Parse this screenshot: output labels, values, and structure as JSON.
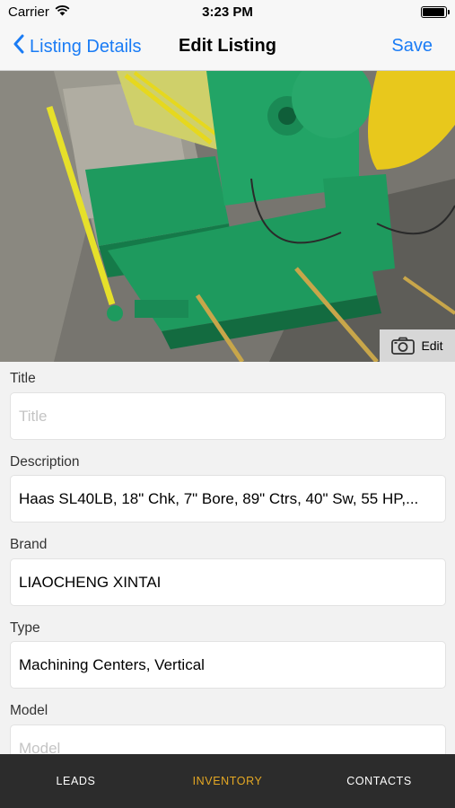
{
  "status_bar": {
    "carrier": "Carrier",
    "time": "3:23 PM",
    "battery_level": 0.95
  },
  "nav": {
    "back_label": "Listing Details",
    "title": "Edit Listing",
    "save_label": "Save",
    "accent_color": "#1a7cf5"
  },
  "photo": {
    "edit_label": "Edit"
  },
  "fields": [
    {
      "label": "Title",
      "value": "",
      "placeholder": "Title"
    },
    {
      "label": "Description",
      "value": "Haas SL40LB, 18\" Chk, 7\" Bore, 89\" Ctrs, 40\" Sw, 55 HP,...",
      "placeholder": ""
    },
    {
      "label": "Brand",
      "value": "LIAOCHENG XINTAI",
      "placeholder": ""
    },
    {
      "label": "Type",
      "value": "Machining Centers, Vertical",
      "placeholder": ""
    },
    {
      "label": "Model",
      "value": "",
      "placeholder": "Model"
    }
  ],
  "tabs": [
    {
      "label": "LEADS",
      "active": false
    },
    {
      "label": "INVENTORY",
      "active": true
    },
    {
      "label": "CONTACTS",
      "active": false
    }
  ],
  "colors": {
    "tab_active": "#e5a823",
    "tab_bar_bg": "#2c2c2c",
    "machine_green": "#1e9a5e",
    "safety_yellow": "#e6d81e"
  }
}
